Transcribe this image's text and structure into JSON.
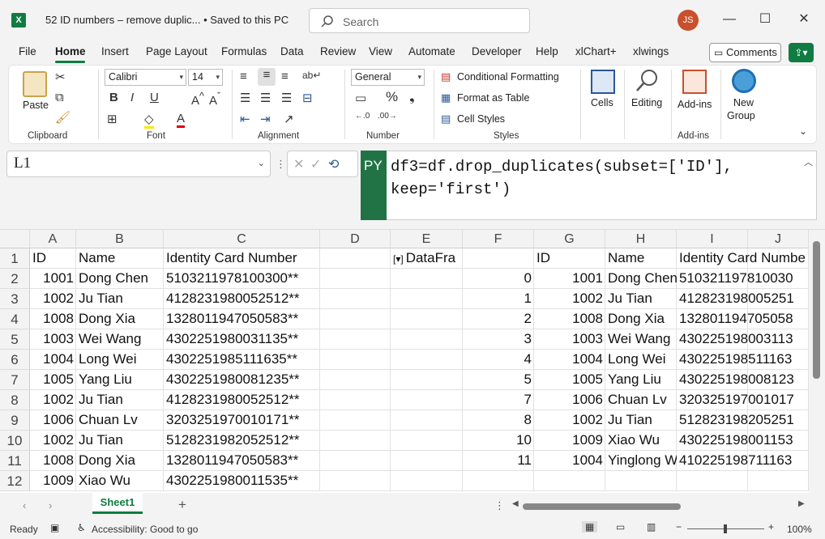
{
  "title_bar": {
    "app_icon": "X",
    "doc_title": "52 ID numbers – remove duplic... • Saved to this PC",
    "search_placeholder": "Search",
    "avatar": "JS"
  },
  "menu_tabs": [
    "File",
    "Home",
    "Insert",
    "Page Layout",
    "Formulas",
    "Data",
    "Review",
    "View",
    "Automate",
    "Developer",
    "Help",
    "xlChart+",
    "xlwings"
  ],
  "comments_label": "Comments",
  "ribbon": {
    "clipboard": {
      "paste": "Paste",
      "group": "Clipboard"
    },
    "font": {
      "name": "Calibri",
      "size": "14",
      "group": "Font"
    },
    "alignment": {
      "group": "Alignment"
    },
    "number": {
      "format": "General",
      "group": "Number"
    },
    "styles": {
      "conditional": "Conditional Formatting",
      "format_table": "Format as Table",
      "cell_styles": "Cell Styles",
      "group": "Styles"
    },
    "cells": {
      "label": "Cells"
    },
    "editing": {
      "label": "Editing"
    },
    "addins": {
      "label": "Add-ins",
      "group": "Add-ins"
    },
    "new_group": {
      "label1": "New",
      "label2": "Group"
    }
  },
  "formula_bar": {
    "name_box": "L1",
    "badge": "PY",
    "line1": "df3=df.drop_duplicates(subset=['ID'],",
    "line2": "keep='first')"
  },
  "grid": {
    "columns": [
      "A",
      "B",
      "C",
      "D",
      "E",
      "F",
      "G",
      "H",
      "I",
      "J"
    ],
    "rows": [
      "1",
      "2",
      "3",
      "4",
      "5",
      "6",
      "7",
      "8",
      "9",
      "10",
      "11",
      "12"
    ],
    "headers_left": [
      "ID",
      "Name",
      "Identity Card Number"
    ],
    "left_data": [
      [
        "1001",
        "Dong Chen",
        "5103211978100300**"
      ],
      [
        "1002",
        "Ju Tian",
        "4128231980052512**"
      ],
      [
        "1008",
        "Dong Xia",
        "1328011947050583**"
      ],
      [
        "1003",
        "Wei Wang",
        "4302251980031135**"
      ],
      [
        "1004",
        "Long Wei",
        "4302251985111635**"
      ],
      [
        "1005",
        "Yang Liu",
        "4302251980081235**"
      ],
      [
        "1002",
        "Ju Tian",
        "4128231980052512**"
      ],
      [
        "1006",
        "Chuan Lv",
        "3203251970010171**"
      ],
      [
        "1002",
        "Ju Tian",
        "5128231982052512**"
      ],
      [
        "1008",
        "Dong Xia",
        "1328011947050583**"
      ],
      [
        "1009",
        "Xiao Wu",
        "4302251980011535**"
      ]
    ],
    "df_label": "DataFra",
    "df_icon": "[▾]",
    "headers_right": [
      "ID",
      "Name",
      "Identity Card Numbe"
    ],
    "right_data": [
      [
        "0",
        "1001",
        "Dong Chen",
        "510321197810030"
      ],
      [
        "1",
        "1002",
        "Ju Tian",
        "412823198005251"
      ],
      [
        "2",
        "1008",
        "Dong Xia",
        "132801194705058"
      ],
      [
        "3",
        "1003",
        "Wei Wang",
        "430225198003113"
      ],
      [
        "4",
        "1004",
        "Long Wei",
        "430225198511163"
      ],
      [
        "5",
        "1005",
        "Yang Liu",
        "430225198008123"
      ],
      [
        "7",
        "1006",
        "Chuan Lv",
        "320325197001017"
      ],
      [
        "8",
        "1002",
        "Ju Tian",
        "512823198205251"
      ],
      [
        "10",
        "1009",
        "Xiao Wu",
        "430225198001153"
      ],
      [
        "11",
        "1004",
        "Yinglong W",
        "410225198711163"
      ]
    ]
  },
  "sheet_tab": "Sheet1",
  "status": {
    "ready": "Ready",
    "accessibility": "Accessibility: Good to go",
    "zoom": "100%"
  },
  "colors": {
    "accent": "#107c41",
    "py_badge": "#217346",
    "avatar": "#c8502d"
  }
}
